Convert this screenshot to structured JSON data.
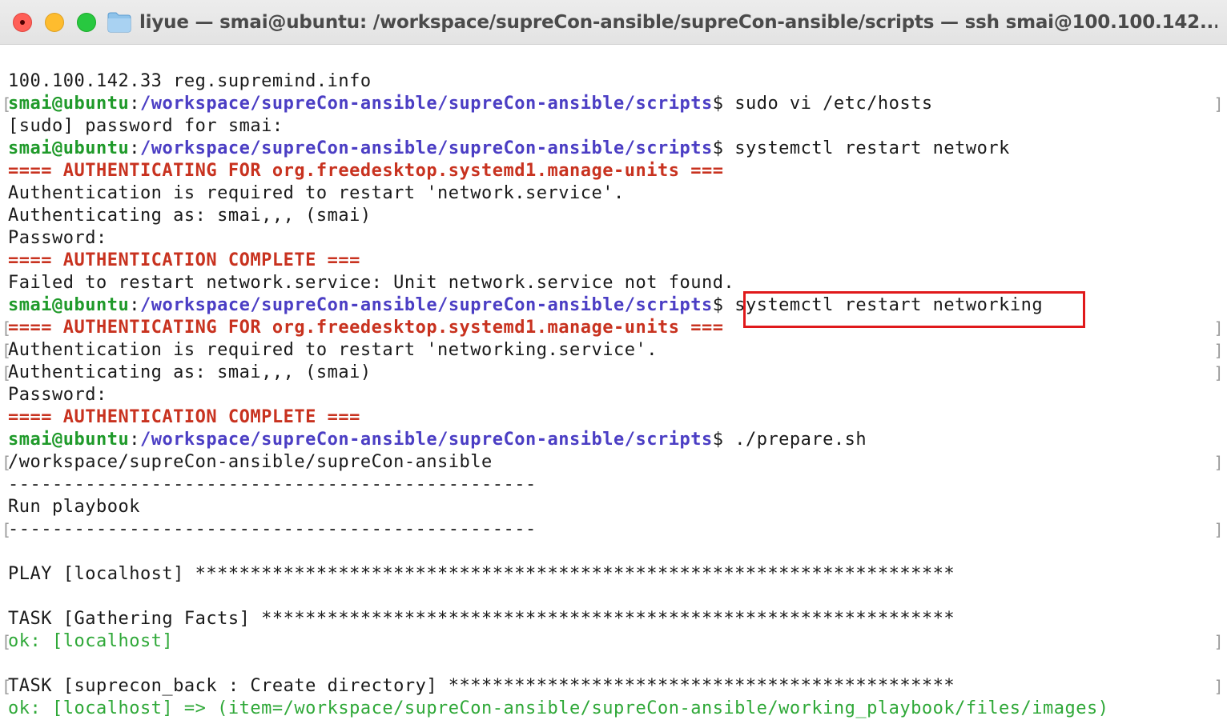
{
  "window": {
    "title": "liyue — smai@ubuntu: /workspace/supreCon-ansible/supreCon-ansible/scripts — ssh smai@100.100.142..."
  },
  "terminal": {
    "lines": [
      {
        "type": "text",
        "text": "100.100.142.33 reg.supremind.info"
      },
      {
        "type": "prompt",
        "user": "smai@ubuntu",
        "colon": ":",
        "path": "/workspace/supreCon-ansible/supreCon-ansible/scripts",
        "dollar": "$ ",
        "cmd": "sudo vi /etc/hosts",
        "lb": "[",
        "rb": "]"
      },
      {
        "type": "text",
        "text": "[sudo] password for smai:"
      },
      {
        "type": "prompt",
        "user": "smai@ubuntu",
        "colon": ":",
        "path": "/workspace/supreCon-ansible/supreCon-ansible/scripts",
        "dollar": "$ ",
        "cmd": "systemctl restart network"
      },
      {
        "type": "red",
        "text": "==== AUTHENTICATING FOR org.freedesktop.systemd1.manage-units ==="
      },
      {
        "type": "text",
        "text": "Authentication is required to restart 'network.service'."
      },
      {
        "type": "text",
        "text": "Authenticating as: smai,,, (smai)"
      },
      {
        "type": "text",
        "text": "Password:"
      },
      {
        "type": "red",
        "text": "==== AUTHENTICATION COMPLETE ==="
      },
      {
        "type": "text",
        "text": "Failed to restart network.service: Unit network.service not found."
      },
      {
        "type": "prompt",
        "user": "smai@ubuntu",
        "colon": ":",
        "path": "/workspace/supreCon-ansible/supreCon-ansible/scripts",
        "dollar": "$ ",
        "cmd": "systemctl restart networking"
      },
      {
        "type": "red",
        "text": "==== AUTHENTICATING FOR org.freedesktop.systemd1.manage-units ===",
        "lb": "[",
        "rb": "]"
      },
      {
        "type": "text",
        "text": "Authentication is required to restart 'networking.service'.",
        "lb": "[",
        "rb": "]"
      },
      {
        "type": "text",
        "text": "Authenticating as: smai,,, (smai)",
        "lb": "[",
        "rb": "]"
      },
      {
        "type": "text",
        "text": "Password:"
      },
      {
        "type": "red",
        "text": "==== AUTHENTICATION COMPLETE ==="
      },
      {
        "type": "prompt",
        "user": "smai@ubuntu",
        "colon": ":",
        "path": "/workspace/supreCon-ansible/supreCon-ansible/scripts",
        "dollar": "$ ",
        "cmd": "./prepare.sh"
      },
      {
        "type": "text",
        "text": "/workspace/supreCon-ansible/supreCon-ansible",
        "lb": "[",
        "rb": "]"
      },
      {
        "type": "text",
        "text": "------------------------------------------------"
      },
      {
        "type": "text",
        "text": "Run playbook"
      },
      {
        "type": "text",
        "text": "------------------------------------------------",
        "lb": "[",
        "rb": "]"
      },
      {
        "type": "text",
        "text": ""
      },
      {
        "type": "text",
        "text": "PLAY [localhost] *********************************************************************"
      },
      {
        "type": "text",
        "text": ""
      },
      {
        "type": "text",
        "text": "TASK [Gathering Facts] ***************************************************************"
      },
      {
        "type": "green",
        "text": "ok: [localhost]",
        "lb": "[",
        "rb": "]"
      },
      {
        "type": "text",
        "text": ""
      },
      {
        "type": "text",
        "text": "TASK [suprecon_back : Create directory] **********************************************",
        "lb": "[",
        "rb": "]"
      },
      {
        "type": "green",
        "text": "ok: [localhost] => (item=/workspace/supreCon-ansible/supreCon-ansible/working_playbook/files/images)"
      }
    ]
  },
  "colors": {
    "prompt_user": "#1f9a2a",
    "prompt_path": "#4b3ec4",
    "auth_header": "#c8321f",
    "ok_output": "#2fa838",
    "highlight_border": "#e0191b"
  }
}
